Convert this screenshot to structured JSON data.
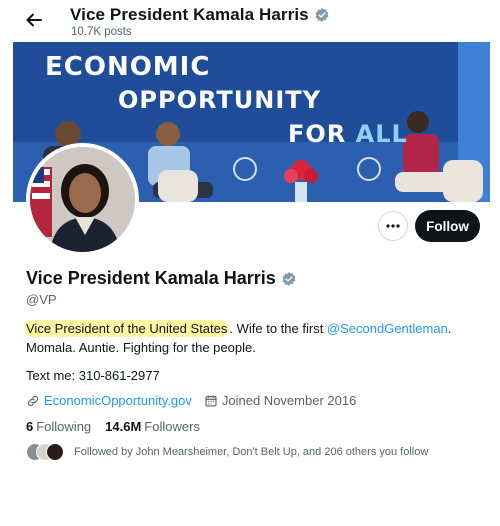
{
  "header": {
    "name": "Vice President Kamala Harris",
    "posts": "10.7K posts"
  },
  "banner": {
    "line1": "ECONOMIC",
    "line2": "OPPORTUNITY",
    "line3_a": "FOR ",
    "line3_b": "ALL"
  },
  "profile": {
    "display_name": "Vice President Kamala Harris",
    "handle": "@VP",
    "bio": {
      "highlight": "Vice President of the United States",
      "text1": ". Wife to the first ",
      "mention": "@SecondGentleman",
      "text2": ". Momala. Auntie. Fighting for the people."
    },
    "text_me": "Text me: 310-861-2977",
    "website": "EconomicOpportunity.gov",
    "joined": "Joined November 2016",
    "following_count": "6",
    "following_label": "Following",
    "followers_count": "14.6M",
    "followers_label": "Followers",
    "followed_by": "Followed by John Mearsheimer, Don't Belt Up, and 206 others you follow"
  },
  "actions": {
    "follow_label": "Follow"
  },
  "colors": {
    "accent": "#1d9bf0",
    "verified": "#829aab",
    "highlight": "#fff6a3",
    "banner_blue": "#1f4d9a"
  },
  "icons": [
    "back-arrow-icon",
    "verified-badge-icon",
    "more-icon",
    "link-icon",
    "calendar-icon"
  ]
}
